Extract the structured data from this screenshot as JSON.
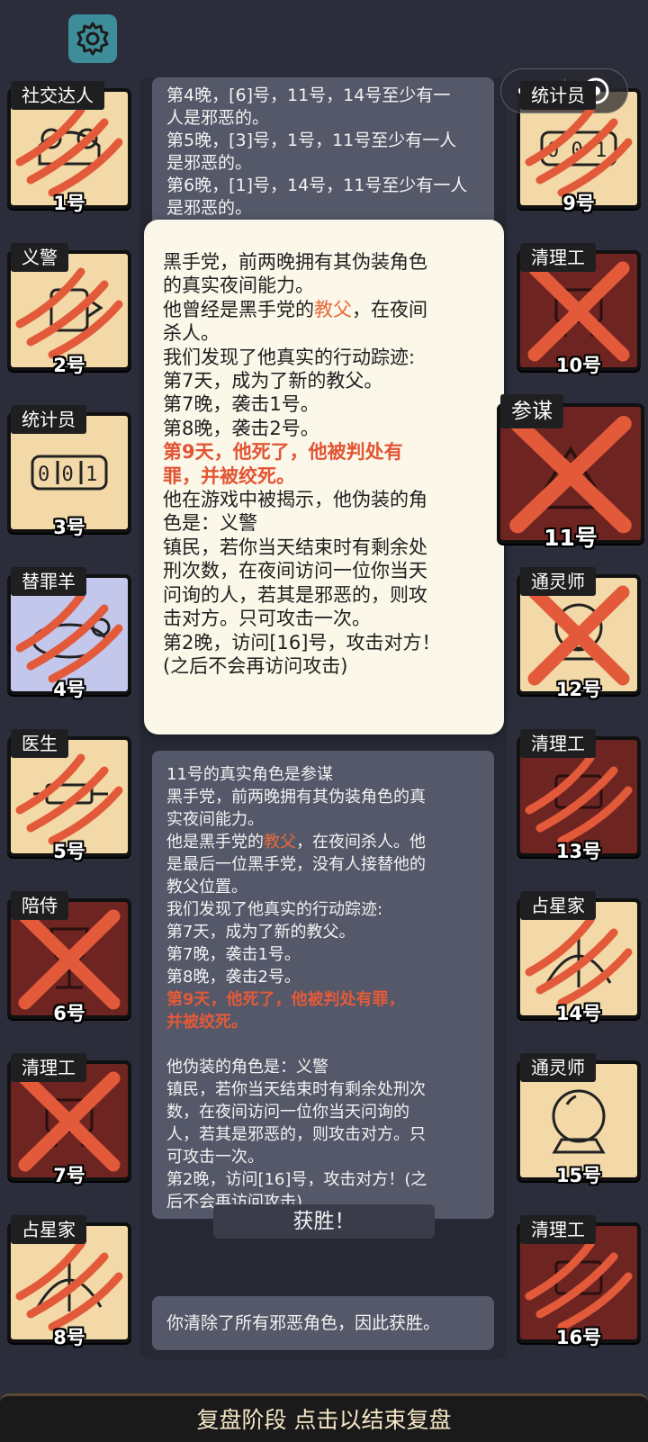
{
  "players": [
    {
      "number": "1号",
      "role": "社交达人",
      "state": "claw",
      "bg": "alive"
    },
    {
      "number": "2号",
      "role": "义警",
      "state": "claw",
      "bg": "alive"
    },
    {
      "number": "3号",
      "role": "统计员",
      "state": "none",
      "bg": "alive"
    },
    {
      "number": "4号",
      "role": "替罪羊",
      "state": "claw",
      "bg": "blue"
    },
    {
      "number": "5号",
      "role": "医生",
      "state": "claw",
      "bg": "alive"
    },
    {
      "number": "6号",
      "role": "陪侍",
      "state": "cross",
      "bg": "dead"
    },
    {
      "number": "7号",
      "role": "清理工",
      "state": "cross",
      "bg": "dead"
    },
    {
      "number": "8号",
      "role": "占星家",
      "state": "claw",
      "bg": "alive"
    },
    {
      "number": "9号",
      "role": "统计员",
      "state": "claw",
      "bg": "alive"
    },
    {
      "number": "10号",
      "role": "清理工",
      "state": "cross",
      "bg": "dead"
    },
    {
      "number": "11号",
      "role": "参谋",
      "state": "cross",
      "bg": "dead"
    },
    {
      "number": "12号",
      "role": "通灵师",
      "state": "cross",
      "bg": "alive"
    },
    {
      "number": "13号",
      "role": "清理工",
      "state": "claw",
      "bg": "dead"
    },
    {
      "number": "14号",
      "role": "占星家",
      "state": "claw",
      "bg": "alive"
    },
    {
      "number": "15号",
      "role": "通灵师",
      "state": "none",
      "bg": "alive"
    },
    {
      "number": "16号",
      "role": "清理工",
      "state": "claw",
      "bg": "dead"
    }
  ],
  "log_top": [
    "第4晚，[6]号，11号，14号至少有一",
    "人是邪恶的。",
    "第5晚，[3]号，1号，11号至少有一人",
    "是邪恶的。",
    "第6晚，[1]号，14号，11号至少有一人",
    "是邪恶的。"
  ],
  "popup": {
    "l1": "黑手党，前两晚拥有其伪装角色",
    "l2": "的真实夜间能力。",
    "l3a": "他曾经是黑手党的",
    "l3b": "教父",
    "l3c": "，在夜间",
    "l4": "杀人。",
    "l5": "我们发现了他真实的行动踪迹:",
    "l6": "第7天，成为了新的教父。",
    "l7": "第7晚，袭击1号。",
    "l8": "第8晚，袭击2号。",
    "l9": "第9天，他死了，他被判处有",
    "l10": "罪，并被绞死。",
    "l11": "他在游戏中被揭示，他伪装的角",
    "l12": "色是：义警",
    "l13": "镇民，若你当天结束时有剩余处",
    "l14": "刑次数，在夜间访问一位你当天",
    "l15": "问询的人，若其是邪恶的，则攻",
    "l16": "击对方。只可攻击一次。",
    "l17": "第2晚，访问[16]号，攻击对方！",
    "l18": "(之后不会再访问攻击)"
  },
  "log_main": {
    "l1": "11号的真实角色是参谋",
    "l2": "黑手党，前两晚拥有其伪装角色的真",
    "l3": "实夜间能力。",
    "l4a": "他是黑手党的",
    "l4b": "教父",
    "l4c": "，在夜间杀人。他",
    "l5": "是最后一位黑手党，没有人接替他的",
    "l6": "教父位置。",
    "l7": "我们发现了他真实的行动踪迹:",
    "l8": "第7天，成为了新的教父。",
    "l9": "第7晚，袭击1号。",
    "l10": "第8晚，袭击2号。",
    "l11": "第9天，他死了，他被判处有罪，",
    "l12": "并被绞死。",
    "l13": "他伪装的角色是：义警",
    "l14": "镇民，若你当天结束时有剩余处刑次",
    "l15": "数，在夜间访问一位你当天问询的",
    "l16": "人，若其是邪恶的，则攻击对方。只",
    "l17": "可攻击一次。",
    "l18": "第2晚，访问[16]号，攻击对方！(之",
    "l19": "后不会再访问攻击)"
  },
  "victory_label": "获胜！",
  "victory_text": "你清除了所有邪恶角色，因此获胜。",
  "footer": "复盘阶段 点击以结束复盘",
  "colors": {
    "accent_red": "#e35a3a",
    "panel": "#545868",
    "background": "#2b2d3b"
  }
}
